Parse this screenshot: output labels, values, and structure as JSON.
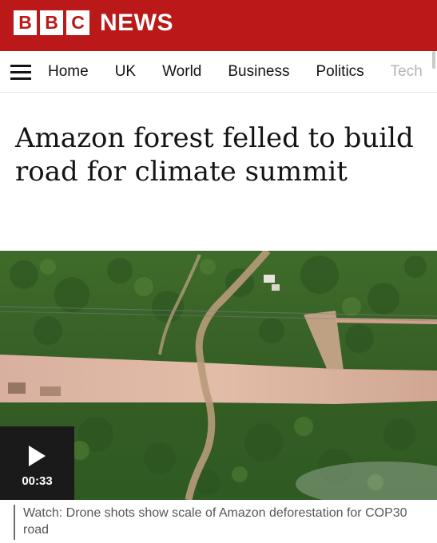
{
  "masthead": {
    "logo_letters": [
      "B",
      "B",
      "C"
    ],
    "wordmark": "NEWS",
    "brand_color": "#bb1919"
  },
  "nav": {
    "menu_icon": "hamburger-menu-icon",
    "items": [
      "Home",
      "UK",
      "World",
      "Business",
      "Politics",
      "Tech"
    ]
  },
  "article": {
    "headline": "Amazon forest felled to build road for climate summit"
  },
  "media": {
    "play_icon": "play-icon",
    "duration": "00:33",
    "caption": "Watch: Drone shots show scale of Amazon deforestation for COP30 road"
  }
}
